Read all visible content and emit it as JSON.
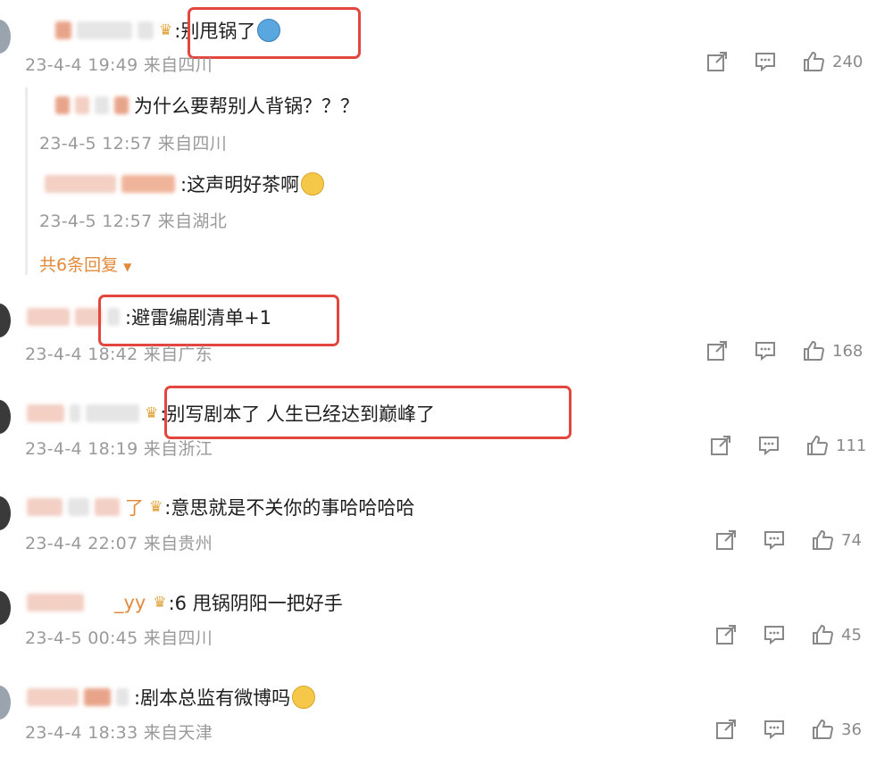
{
  "icons": {
    "share": "share-icon",
    "comment": "comment-icon",
    "like": "thumbs-up-icon",
    "expand": "triangle-down-icon",
    "crown": "crown-badge-icon"
  },
  "colors": {
    "highlight_box": "#e2463e",
    "meta_text": "#9a9a9a",
    "expand_link": "#e28a3a"
  },
  "comments": [
    {
      "name_suffix": "",
      "text": ":别甩锅了",
      "meta": "23-4-4 19:49 来自四川",
      "likes": "240"
    },
    {
      "name_suffix": "",
      "text": ":避雷编剧清单+1",
      "meta": "23-4-4 18:42 来自广东",
      "likes": "168"
    },
    {
      "name_suffix": "",
      "text": ":别写剧本了 人生已经达到巅峰了",
      "meta": "23-4-4 18:19 来自浙江",
      "likes": "111"
    },
    {
      "name_suffix": "了",
      "text": ":意思就是不关你的事哈哈哈哈",
      "meta": "23-4-4 22:07 来自贵州",
      "likes": "74"
    },
    {
      "name_suffix": "_yy",
      "text": ":6 甩锅阴阳一把好手",
      "meta": "23-4-5 00:45 来自四川",
      "likes": "45"
    },
    {
      "name_suffix": "",
      "text": ":剧本总监有微博吗",
      "meta": "23-4-4 18:33 来自天津",
      "likes": "36"
    }
  ],
  "replies": [
    {
      "text": "为什么要帮别人背锅？？？",
      "meta": "23-4-5 12:57 来自四川"
    },
    {
      "text": ":这声明好茶啊",
      "meta": "23-4-5 12:57 来自湖北"
    }
  ],
  "expand_label": "共6条回复"
}
